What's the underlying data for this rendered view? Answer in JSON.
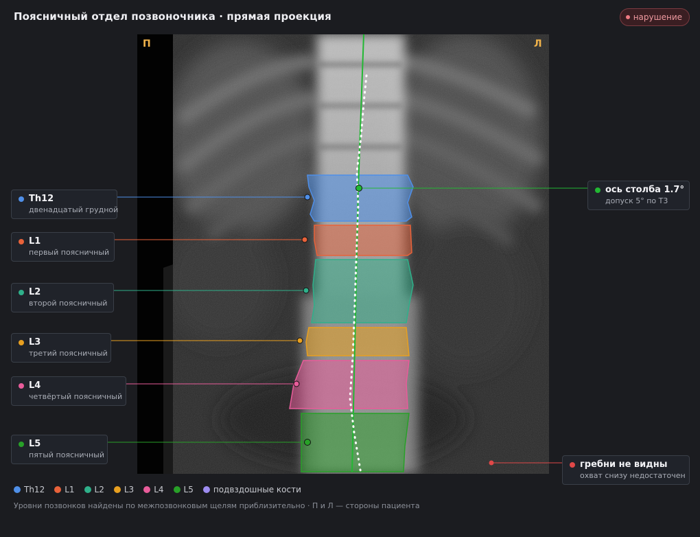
{
  "header": {
    "title": "Поясничный отдел позвоночника · прямая проекция",
    "badge": "нарушение"
  },
  "image": {
    "side_right": "П",
    "side_left": "Л"
  },
  "vertebrae": [
    {
      "id": "Th12",
      "name": "Th12",
      "desc": "двенадцатый грудной",
      "color": "#4f8fe8"
    },
    {
      "id": "L1",
      "name": "L1",
      "desc": "первый поясничный",
      "color": "#e8623a"
    },
    {
      "id": "L2",
      "name": "L2",
      "desc": "второй поясничный",
      "color": "#2fb08a"
    },
    {
      "id": "L3",
      "name": "L3",
      "desc": "третий поясничный",
      "color": "#e8a020"
    },
    {
      "id": "L4",
      "name": "L4",
      "desc": "четвёртый поясничный",
      "color": "#e85c9a"
    },
    {
      "id": "L5",
      "name": "L5",
      "desc": "пятый поясничный",
      "color": "#28a028"
    }
  ],
  "axis": {
    "label": "ось столба 1.7°",
    "desc": "допуск 5° по Т3",
    "color": "#22b833"
  },
  "iliac": {
    "label": "гребни не видны",
    "desc": "охват снизу недостаточен",
    "color": "#e04848"
  },
  "legend": [
    {
      "label": "Th12",
      "color": "#4f8fe8"
    },
    {
      "label": "L1",
      "color": "#e8623a"
    },
    {
      "label": "L2",
      "color": "#2fb08a"
    },
    {
      "label": "L3",
      "color": "#e8a020"
    },
    {
      "label": "L4",
      "color": "#e85c9a"
    },
    {
      "label": "L5",
      "color": "#28a028"
    },
    {
      "label": "подвздошные кости",
      "color": "#9d8cf0"
    }
  ],
  "footnote": "Уровни позвонков найдены по межпозвонковым щелям приблизительно · П и Л — стороны пациента"
}
